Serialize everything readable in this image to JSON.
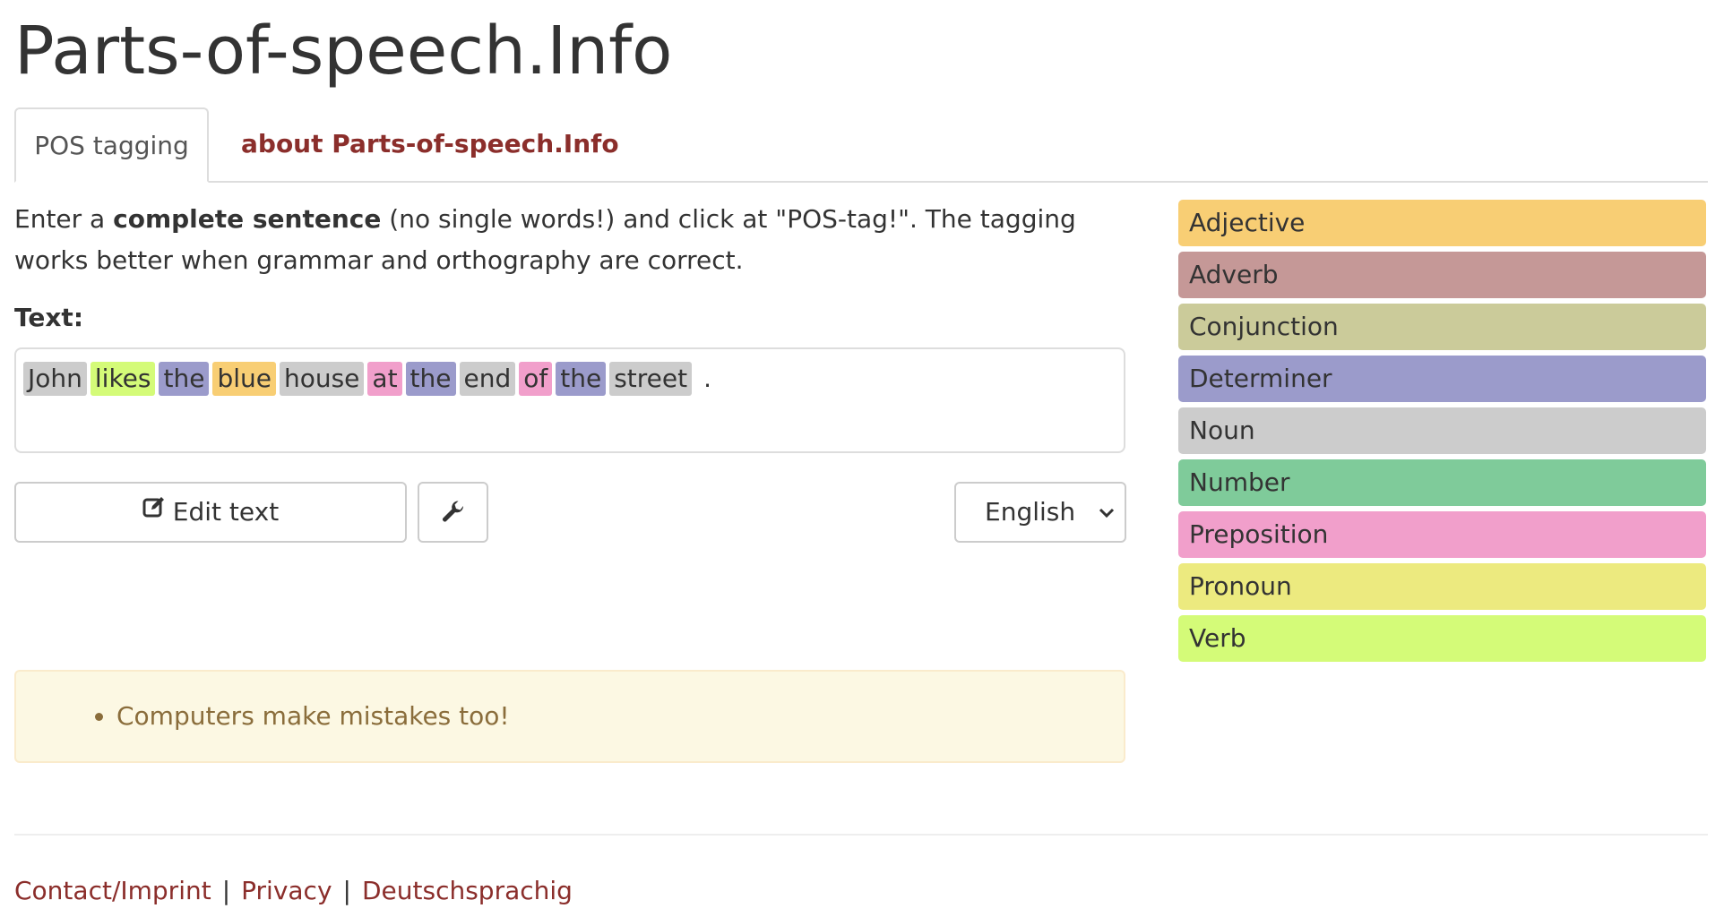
{
  "site": {
    "title": "Parts-of-speech.Info"
  },
  "tabs": [
    {
      "label": "POS tagging",
      "active": true
    },
    {
      "label": "about Parts-of-speech.Info",
      "active": false
    }
  ],
  "intro": {
    "part1": "Enter a ",
    "bold": "complete sentence",
    "part2": " (no single words!) and click at \"POS-tag!\". The tagging works better when grammar and orthography are correct."
  },
  "text_label": "Text:",
  "tokens": [
    {
      "word": "John",
      "pos": "Noun"
    },
    {
      "word": "likes",
      "pos": "Verb"
    },
    {
      "word": "the",
      "pos": "Determiner"
    },
    {
      "word": "blue",
      "pos": "Adjective"
    },
    {
      "word": "house",
      "pos": "Noun"
    },
    {
      "word": "at",
      "pos": "Preposition"
    },
    {
      "word": "the",
      "pos": "Determiner"
    },
    {
      "word": "end",
      "pos": "Noun"
    },
    {
      "word": "of",
      "pos": "Preposition"
    },
    {
      "word": "the",
      "pos": "Determiner"
    },
    {
      "word": "street",
      "pos": "Noun"
    },
    {
      "word": ".",
      "pos": ""
    }
  ],
  "buttons": {
    "edit_text": "Edit text",
    "tools_icon": "wrench-icon",
    "edit_icon": "edit-icon"
  },
  "language_select": {
    "selected": "English"
  },
  "notice": {
    "items": [
      "Computers make mistakes too!"
    ]
  },
  "legend": [
    {
      "label": "Adjective",
      "color": "#f8ce74"
    },
    {
      "label": "Adverb",
      "color": "#c59897"
    },
    {
      "label": "Conjunction",
      "color": "#cbcb9a"
    },
    {
      "label": "Determiner",
      "color": "#9b9bcb"
    },
    {
      "label": "Noun",
      "color": "#cccccc"
    },
    {
      "label": "Number",
      "color": "#7fcb9a"
    },
    {
      "label": "Preposition",
      "color": "#f19fcb"
    },
    {
      "label": "Pronoun",
      "color": "#ecea7f"
    },
    {
      "label": "Verb",
      "color": "#d4fb78"
    }
  ],
  "footer": {
    "links": [
      "Contact/Imprint",
      "Privacy",
      "Deutschsprachig"
    ],
    "separator": "|"
  }
}
